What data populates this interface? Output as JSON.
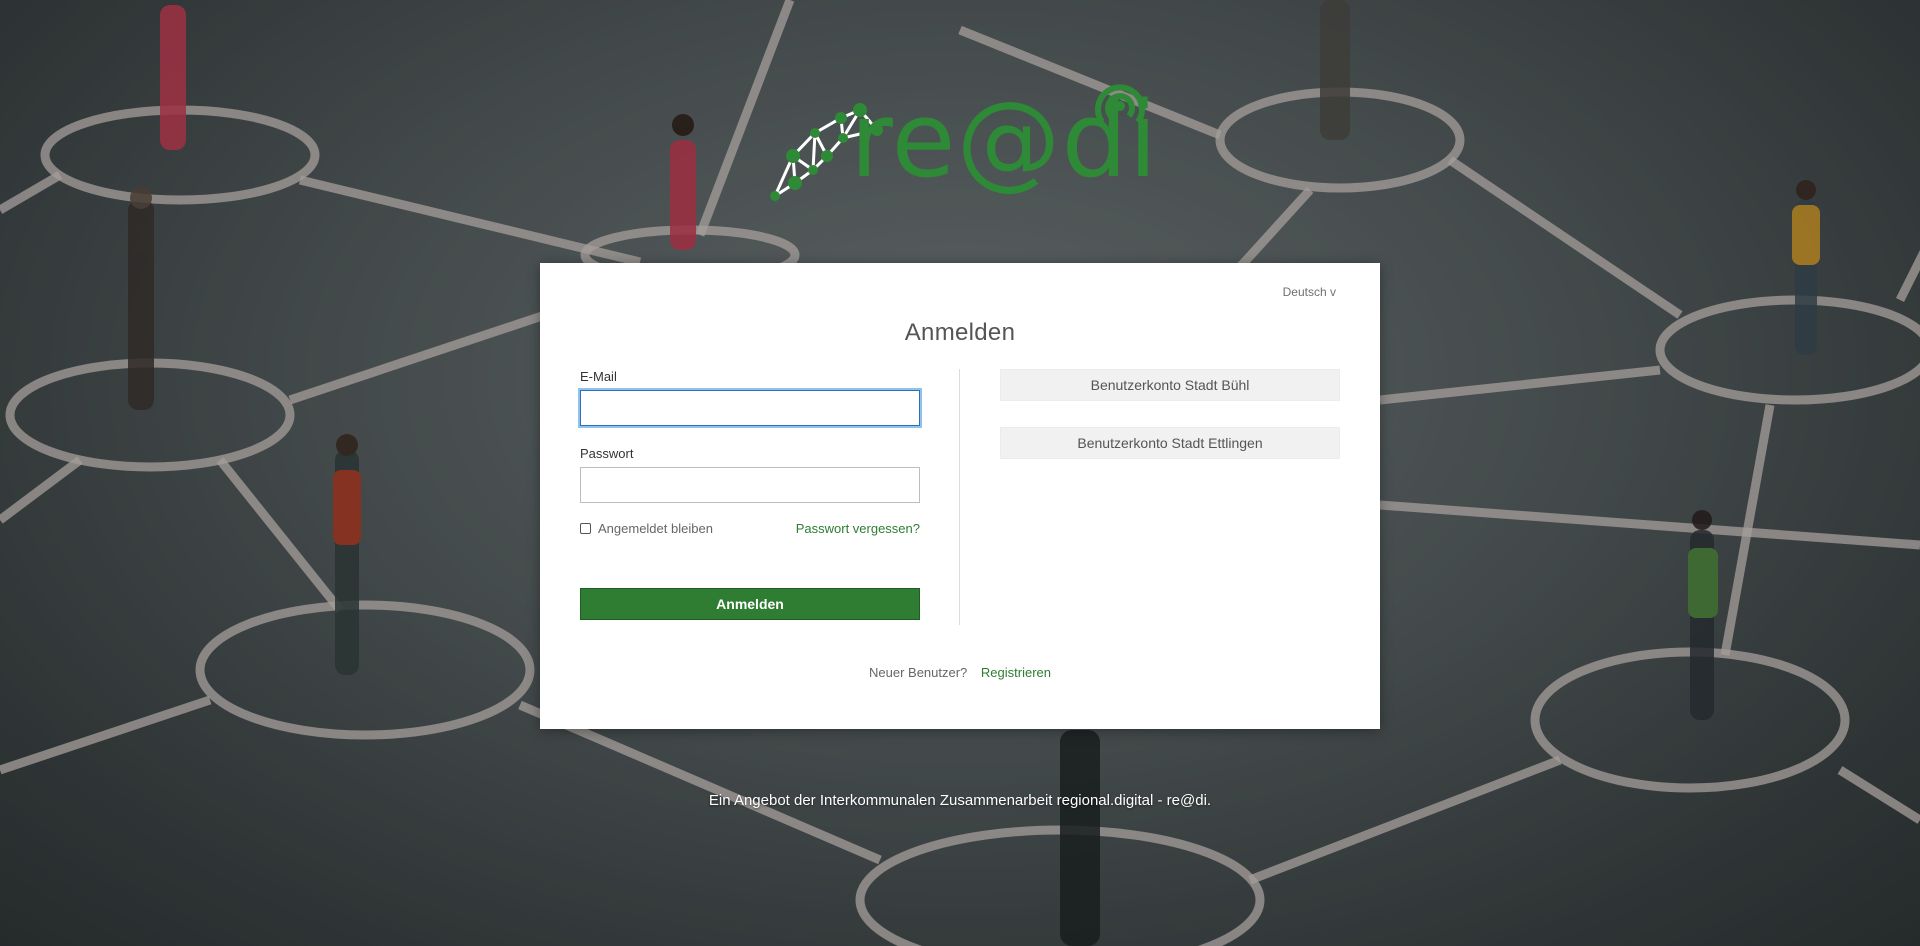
{
  "background": {
    "description_icon": "network-people-background"
  },
  "logo": {
    "text": "re@di",
    "icon": "brain-network-logo-icon",
    "signal_icon": "signal-icon",
    "color": "#2e8a36"
  },
  "card": {
    "language": "Deutsch v",
    "title": "Anmelden",
    "email_label": "E-Mail",
    "email_value": "",
    "password_label": "Passwort",
    "password_value": "",
    "remember_label": "Angemeldet bleiben",
    "remember_checked": false,
    "forgot_link": "Passwort vergessen?",
    "submit_label": "Anmelden",
    "identity_providers": [
      "Benutzerkonto Stadt Bühl",
      "Benutzerkonto Stadt Ettlingen"
    ],
    "new_user_text": "Neuer Benutzer?",
    "register_link": "Registrieren"
  },
  "footer": {
    "text": "Ein Angebot der Interkommunalen Zusammenarbeit regional.digital - re@di."
  },
  "colors": {
    "accent": "#2e7d32",
    "focus": "#2f6fb3",
    "card_bg": "#ffffff"
  }
}
